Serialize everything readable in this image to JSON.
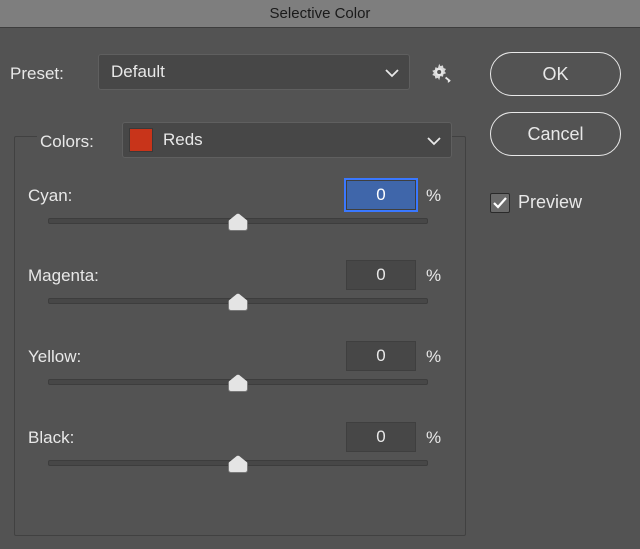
{
  "title": "Selective Color",
  "preset_label": "Preset:",
  "preset_value": "Default",
  "colors_label": "Colors:",
  "colors_value": "Reds",
  "swatch_color": "#c8341a",
  "percent": "%",
  "sliders": {
    "cyan": {
      "label": "Cyan:",
      "value": "0"
    },
    "magenta": {
      "label": "Magenta:",
      "value": "0"
    },
    "yellow": {
      "label": "Yellow:",
      "value": "0"
    },
    "black": {
      "label": "Black:",
      "value": "0"
    }
  },
  "buttons": {
    "ok": "OK",
    "cancel": "Cancel"
  },
  "preview_label": "Preview",
  "preview_checked": true
}
